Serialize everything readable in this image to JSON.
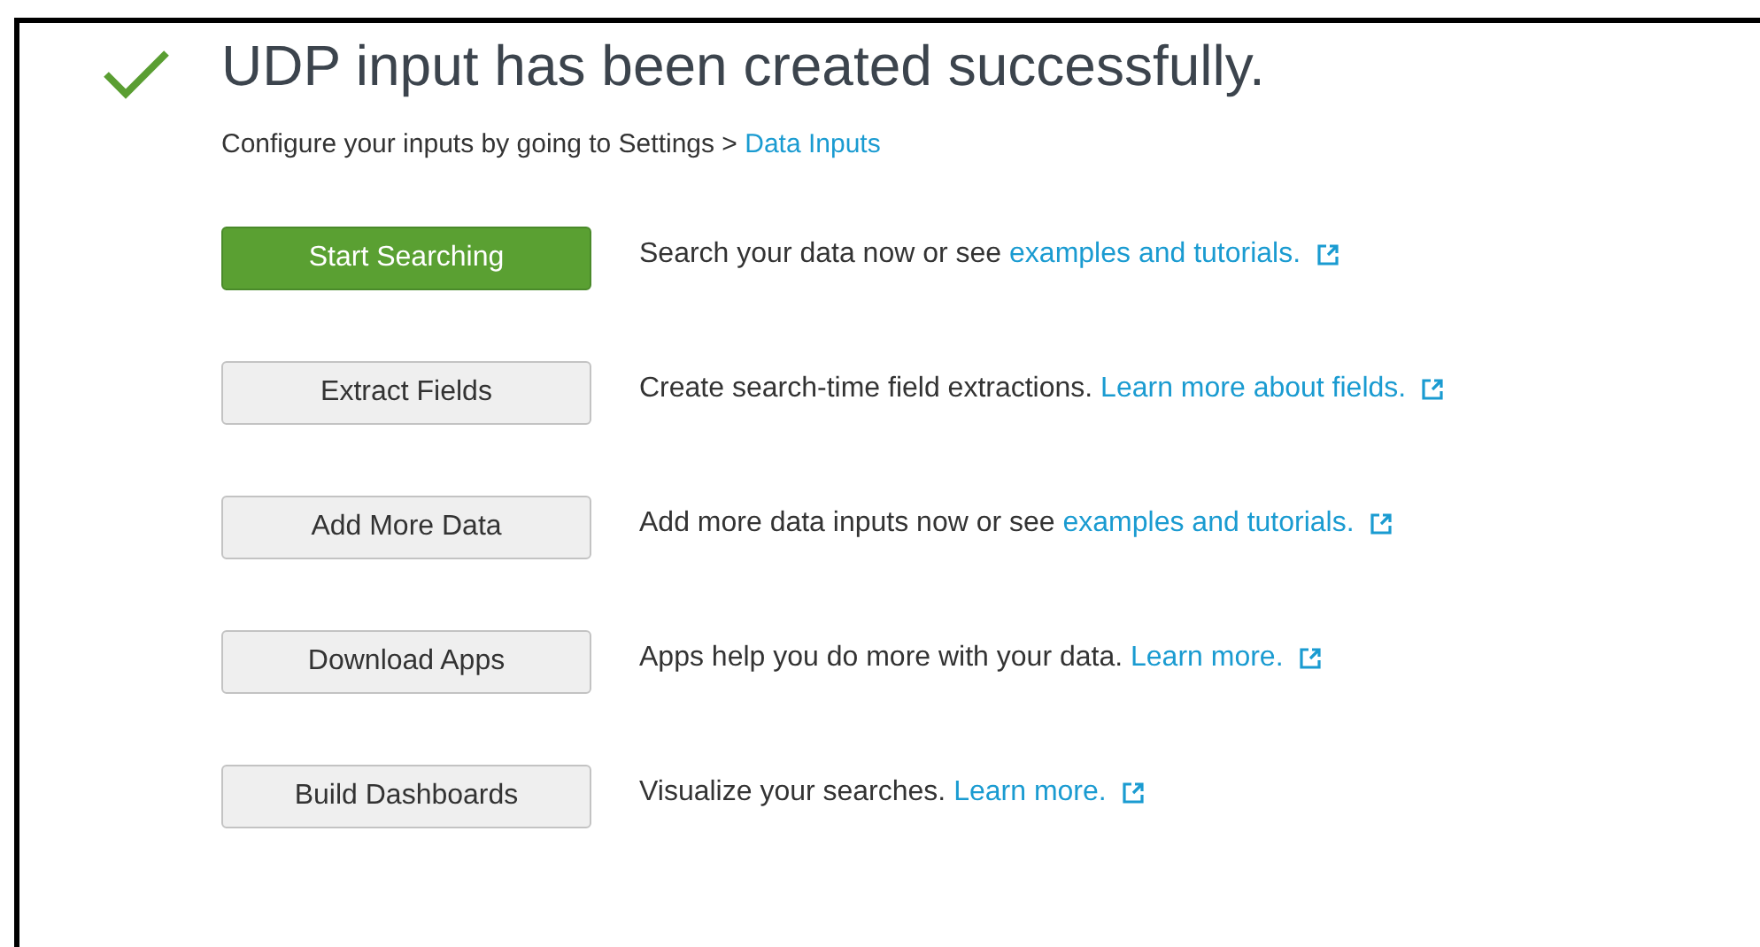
{
  "title": "UDP input has been created successfully.",
  "subtitle": {
    "text": "Configure your inputs by going to Settings > ",
    "link": "Data Inputs"
  },
  "actions": [
    {
      "button": "Start Searching",
      "kind": "primary",
      "description": "Search your data now or see ",
      "link": "examples and tutorials."
    },
    {
      "button": "Extract Fields",
      "kind": "default",
      "description": "Create search-time field extractions. ",
      "link": "Learn more about fields."
    },
    {
      "button": "Add More Data",
      "kind": "default",
      "description": "Add more data inputs now or see ",
      "link": "examples and tutorials."
    },
    {
      "button": "Download Apps",
      "kind": "default",
      "description": "Apps help you do more with your data. ",
      "link": "Learn more."
    },
    {
      "button": "Build Dashboards",
      "kind": "default",
      "description": "Visualize your searches. ",
      "link": "Learn more."
    }
  ]
}
